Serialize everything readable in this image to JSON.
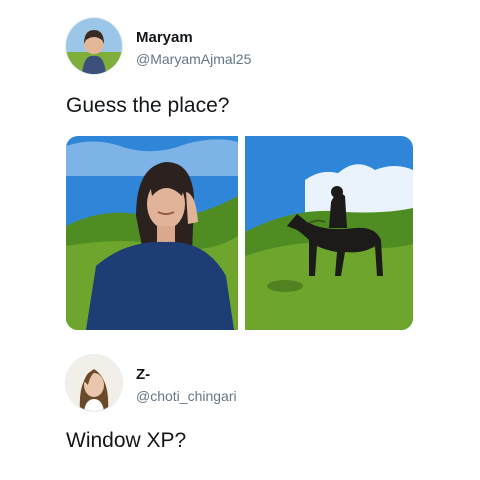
{
  "tweet": {
    "author": {
      "name": "Maryam",
      "handle": "@MaryamAjmal25"
    },
    "text": "Guess the place?",
    "media": [
      {
        "icon": "selfie-photo",
        "description_kind": "photo"
      },
      {
        "icon": "horse-rider-photo",
        "description_kind": "photo"
      }
    ]
  },
  "reply": {
    "author": {
      "name": "Z-",
      "handle": "@choti_chingari"
    },
    "text": "Window XP?"
  },
  "colors": {
    "sky": "#2f86d8",
    "grass": "#6ea52d",
    "handle_gray": "#657786",
    "text_dark": "#14171a"
  }
}
